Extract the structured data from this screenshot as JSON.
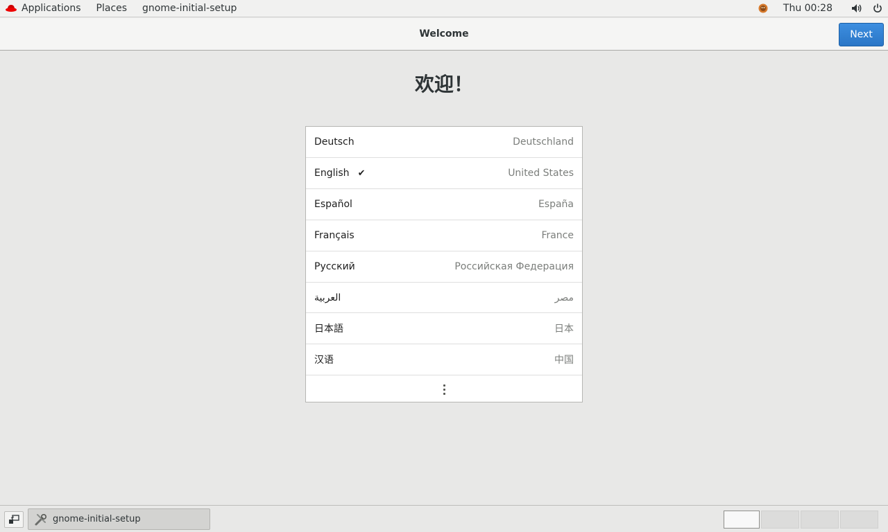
{
  "top_panel": {
    "applications_label": "Applications",
    "places_label": "Places",
    "app_label": "gnome-initial-setup",
    "clock": "Thu 00:28"
  },
  "header": {
    "title": "Welcome",
    "next_label": "Next"
  },
  "main": {
    "heading": "欢迎！",
    "languages": [
      {
        "name": "Deutsch",
        "region": "Deutschland",
        "selected": false
      },
      {
        "name": "English",
        "region": "United States",
        "selected": true
      },
      {
        "name": "Español",
        "region": "España",
        "selected": false
      },
      {
        "name": "Français",
        "region": "France",
        "selected": false
      },
      {
        "name": "Русский",
        "region": "Российская Федерация",
        "selected": false
      },
      {
        "name": "العربية",
        "region": "مصر",
        "selected": false
      },
      {
        "name": "日本語",
        "region": "日本",
        "selected": false
      },
      {
        "name": "汉语",
        "region": "中国",
        "selected": false
      }
    ],
    "check_mark": "✔"
  },
  "bottom_panel": {
    "task_label": "gnome-initial-setup",
    "workspace_count": 4,
    "active_workspace": 1
  },
  "colors": {
    "accent": "#2a76c6",
    "background": "#e8e8e7"
  },
  "icons": {
    "top_left": "redhat-icon",
    "status": [
      "user-avatar-icon",
      "volume-icon",
      "power-icon"
    ],
    "more": "more-vertical-icon",
    "task": "setup-tools-icon",
    "show_desktop": "show-desktop-icon"
  }
}
